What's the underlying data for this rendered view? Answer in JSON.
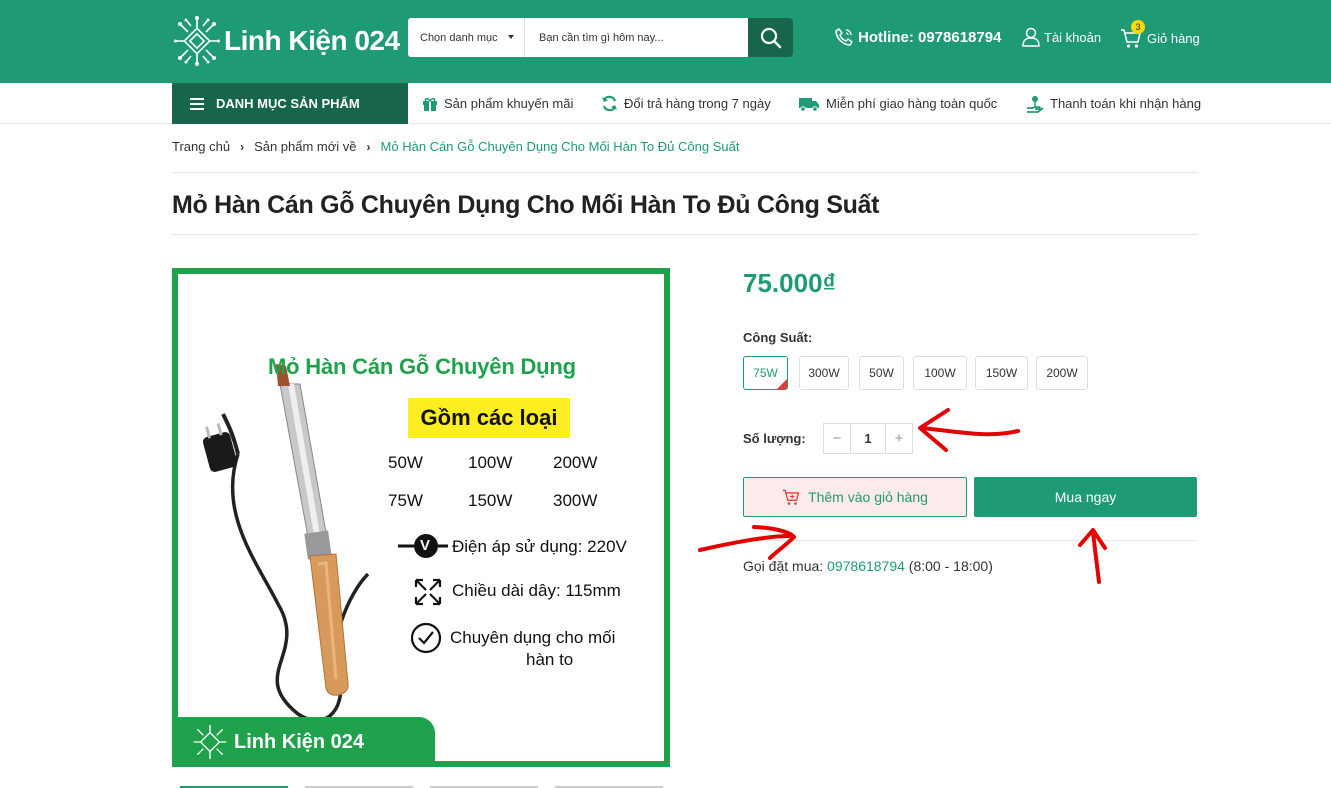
{
  "header": {
    "logo_text": "Linh Kiện 024",
    "search_category": "Chọn danh mục",
    "search_placeholder": "Bạn cần tìm gì hôm nay...",
    "hotline": "Hotline: 0978618794",
    "account_label": "Tài khoản",
    "cart_label": "Giỏ hàng",
    "cart_count": "3"
  },
  "nav": {
    "menu_label": "DANH MỤC SẢN PHẨM",
    "items": [
      {
        "label": "Sản phẩm khuyến mãi",
        "icon": "gift-icon"
      },
      {
        "label": "Đổi trả hàng trong 7 ngày",
        "icon": "refresh-icon"
      },
      {
        "label": "Miễn phí giao hàng toàn quốc",
        "icon": "truck-icon"
      },
      {
        "label": "Thanh toán khi nhận hàng",
        "icon": "hand-coin-icon"
      }
    ]
  },
  "breadcrumb": {
    "items": [
      "Trang chủ",
      "Sản phẩm mới về"
    ],
    "current": "Mỏ Hàn Cán Gỗ Chuyên Dụng Cho Mối Hàn To Đủ Công Suất"
  },
  "product": {
    "title": "Mỏ Hàn Cán Gỗ Chuyên Dụng Cho Mối Hàn To Đủ Công Suất",
    "price": "75.000₫",
    "option_label": "Công Suất:",
    "options": [
      "75W",
      "300W",
      "50W",
      "100W",
      "150W",
      "200W"
    ],
    "selected_option": "75W",
    "qty_label": "Số lượng:",
    "qty_minus": "−",
    "qty_value": "1",
    "qty_plus": "+",
    "add_to_cart": "Thêm vào giỏ hàng",
    "buy_now": "Mua ngay",
    "call_prefix": "Gọi đặt mua: ",
    "call_phone": "0978618794",
    "call_hours": " (8:00 - 18:00)"
  },
  "image": {
    "heading": "Mỏ Hàn Cán Gỗ Chuyên Dụng",
    "band": "Gồm các loại",
    "watts": [
      "50W",
      "100W",
      "200W",
      "75W",
      "150W",
      "300W"
    ],
    "spec_voltage": "Điện áp sử dụng: 220V",
    "spec_length": "Chiều dài dây: 115mm",
    "spec_use_1": "Chuyên dụng cho mối",
    "spec_use_2": "hàn to",
    "voltage_symbol": "V",
    "footer_logo": "Linh Kiện 024"
  },
  "colors": {
    "brand": "#1e9b74",
    "brand_dark": "#17664c",
    "image_green": "#1fa24b",
    "annotation_red": "#e30000"
  }
}
